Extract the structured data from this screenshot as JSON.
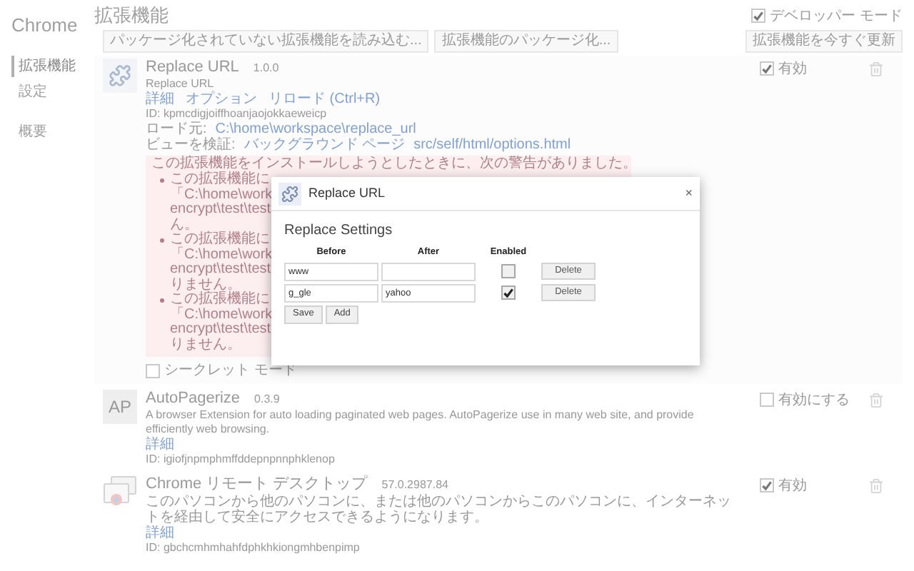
{
  "sidebar": {
    "title": "Chrome",
    "items": [
      {
        "label": "拡張機能",
        "selected": true
      },
      {
        "label": "設定",
        "selected": false
      },
      {
        "label": "概要",
        "selected": false
      }
    ]
  },
  "header": {
    "title": "拡張機能",
    "developer_mode": {
      "label": "デベロッパー モード",
      "checked": true
    }
  },
  "toolbar": {
    "left_buttons": [
      "パッケージ化されていない拡張機能を読み込む...",
      "拡張機能のパッケージ化..."
    ],
    "right_button": "拡張機能を今すぐ更新"
  },
  "extensions": [
    {
      "name": "Replace URL",
      "version": "1.0.0",
      "description": "Replace URL",
      "links": [
        "詳細",
        "オプション",
        "リロード (Ctrl+R)"
      ],
      "details": [
        {
          "label": "ID: kpmcdigjoiffhoanjaojokkaeweicp"
        },
        {
          "label": "ロード元:",
          "parts": [
            {
              "text": "C:\\home\\workspace\\replace_url",
              "kind": "link"
            }
          ]
        },
        {
          "label": "ビューを検証:",
          "parts": [
            {
              "text": "バックグラウンド ページ",
              "kind": "link"
            },
            {
              "text": "src/self/html/options.html",
              "kind": "link"
            }
          ]
        }
      ],
      "warning": {
        "title": "この拡張機能をインストールしようとしたときに、次の警告がありました。",
        "bullets": [
          {
            "lines": [
              "この拡張機能に",
              "「C:\\home\\work",
              "encrypt\\test\\test",
              "ん。"
            ]
          },
          {
            "lines": [
              "この拡張機能に",
              "「C:\\home\\work",
              "encrypt\\test\\test",
              "りません。"
            ]
          },
          {
            "lines": [
              "この拡張機能に",
              "「C:\\home\\work",
              "encrypt\\test\\test",
              "りません。"
            ]
          }
        ]
      },
      "incognito": {
        "label": "シークレット モード",
        "checked": false
      },
      "enabled": {
        "label": "有効",
        "checked": true
      }
    },
    {
      "icon_text": "AP",
      "name": "AutoPagerize",
      "version": "0.3.9",
      "description": "A browser Extension for auto loading paginated web pages. AutoPagerize use in many web site, and provide efficiently web browsing.",
      "links": [
        "詳細"
      ],
      "details": [
        {
          "label": "ID: igiofjnpmphmffddepnpnnphklenop"
        }
      ],
      "enabled": {
        "label": "有効にする",
        "checked": false
      }
    },
    {
      "name": "Chrome リモート デスクトップ",
      "version": "57.0.2987.84",
      "description": "このパソコンから他のパソコンに、または他のパソコンからこのパソコンに、インターネットを経由して安全にアクセスできるようになります。",
      "links": [
        "詳細"
      ],
      "details": [
        {
          "label": "ID: gbchcmhmhahfdphkhkiongmhbenpimp"
        }
      ],
      "enabled": {
        "label": "有効",
        "checked": true
      }
    }
  ],
  "dialog": {
    "title": "Replace URL",
    "close": "×",
    "heading": "Replace Settings",
    "columns": [
      "Before",
      "After",
      "Enabled"
    ],
    "rows": [
      {
        "before": "www",
        "enabled": false,
        "delete": "Delete"
      },
      {
        "before": "g_gle",
        "after": "yahoo",
        "enabled": true,
        "delete": "Delete"
      }
    ],
    "buttons": [
      "Save",
      "Add"
    ]
  }
}
